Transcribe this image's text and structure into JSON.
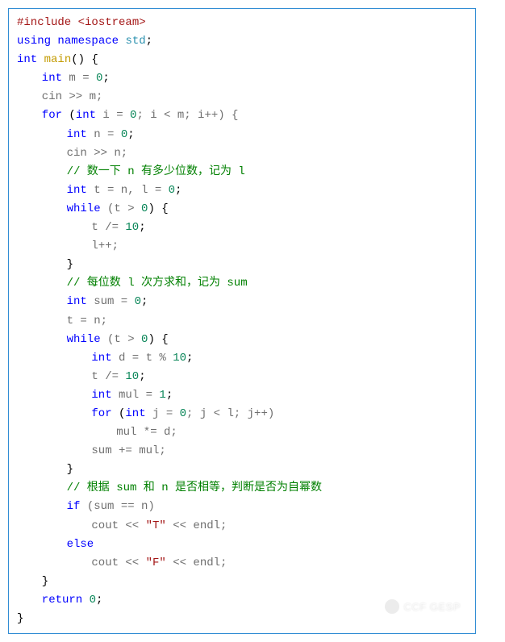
{
  "code": {
    "l1": {
      "pre": "#include ",
      "hdr": "<iostream>"
    },
    "l2": {
      "a": "using ",
      "b": "namespace ",
      "c": "std",
      "d": ";"
    },
    "l3": {
      "a": "int ",
      "b": "main",
      "c": "() {"
    },
    "l4": {
      "a": "int ",
      "b": "m = ",
      "c": "0",
      "d": ";"
    },
    "l5": {
      "a": "cin >> m;"
    },
    "l6": {
      "a": "for ",
      "b": "(",
      "c": "int ",
      "d": "i = ",
      "e": "0",
      "f": "; i < m; i++) {"
    },
    "l7": {
      "a": "int ",
      "b": "n = ",
      "c": "0",
      "d": ";"
    },
    "l8": {
      "a": "cin >> n;"
    },
    "l9": {
      "a": "// 数一下 n 有多少位数，记为 l"
    },
    "l10": {
      "a": "int ",
      "b": "t = n, l = ",
      "c": "0",
      "d": ";"
    },
    "l11": {
      "a": "while ",
      "b": "(t > ",
      "c": "0",
      "d": ") {"
    },
    "l12": {
      "a": "t /= ",
      "b": "10",
      "c": ";"
    },
    "l13": {
      "a": "l++;"
    },
    "l14": {
      "a": "}"
    },
    "l15": {
      "a": "// 每位数 l 次方求和，记为 sum"
    },
    "l16": {
      "a": "int ",
      "b": "sum = ",
      "c": "0",
      "d": ";"
    },
    "l17": {
      "a": "t = n;"
    },
    "l18": {
      "a": "while ",
      "b": "(t > ",
      "c": "0",
      "d": ") {"
    },
    "l19": {
      "a": "int ",
      "b": "d = t % ",
      "c": "10",
      "d": ";"
    },
    "l20": {
      "a": "t /= ",
      "b": "10",
      "c": ";"
    },
    "l21": {
      "a": "int ",
      "b": "mul = ",
      "c": "1",
      "d": ";"
    },
    "l22": {
      "a": "for ",
      "b": "(",
      "c": "int ",
      "d": "j = ",
      "e": "0",
      "f": "; j < l; j++)"
    },
    "l23": {
      "a": "mul *= d;"
    },
    "l24": {
      "a": "sum += mul;"
    },
    "l25": {
      "a": "}"
    },
    "l26": {
      "a": "// 根据 sum 和 n 是否相等，判断是否为自幂数"
    },
    "l27": {
      "a": "if ",
      "b": "(sum == n)"
    },
    "l28": {
      "a": "cout << ",
      "b": "\"T\"",
      "c": " << endl;"
    },
    "l29": {
      "a": "else"
    },
    "l30": {
      "a": "cout << ",
      "b": "\"F\"",
      "c": " << endl;"
    },
    "l31": {
      "a": "}"
    },
    "l32": {
      "a": "return ",
      "b": "0",
      "c": ";"
    },
    "l33": {
      "a": "}"
    }
  },
  "watermark": "CCF GESP"
}
